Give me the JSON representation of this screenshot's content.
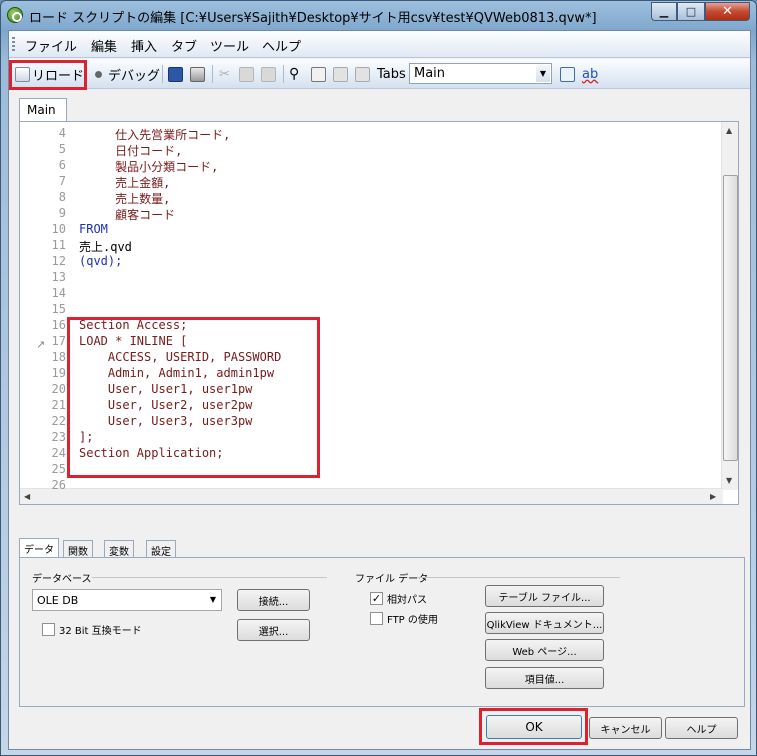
{
  "window": {
    "title": "ロード スクリプトの編集 [C:¥Users¥Sajith¥Desktop¥サイト用csv¥test¥QVWeb0813.qvw*]"
  },
  "menu": [
    "ファイル",
    "編集",
    "挿入",
    "タブ",
    "ツール",
    "ヘルプ"
  ],
  "toolbar": {
    "reload_label": "リロード",
    "debug_label": "デバッグ",
    "tabs_label": "Tabs",
    "tabs_value": "Main"
  },
  "editor_tab": "Main",
  "lines": [
    {
      "n": "4",
      "t": "     仕入先営業所コード,"
    },
    {
      "n": "5",
      "t": "     日付コード,"
    },
    {
      "n": "6",
      "t": "     製品小分類コード,"
    },
    {
      "n": "7",
      "t": "     売上金額,"
    },
    {
      "n": "8",
      "t": "     売上数量,"
    },
    {
      "n": "9",
      "t": "     顧客コード"
    },
    {
      "n": "10",
      "t": "FROM"
    },
    {
      "n": "11",
      "t": "売上.qvd"
    },
    {
      "n": "12",
      "t": "(qvd);"
    },
    {
      "n": "13",
      "t": ""
    },
    {
      "n": "14",
      "t": ""
    },
    {
      "n": "15",
      "t": ""
    },
    {
      "n": "16",
      "t": "Section Access;"
    },
    {
      "n": "17",
      "t": "LOAD * INLINE ["
    },
    {
      "n": "18",
      "t": "    ACCESS, USERID, PASSWORD"
    },
    {
      "n": "19",
      "t": "    Admin, Admin1, admin1pw"
    },
    {
      "n": "20",
      "t": "    User, User1, user1pw"
    },
    {
      "n": "21",
      "t": "    User, User2, user2pw"
    },
    {
      "n": "22",
      "t": "    User, User3, user3pw"
    },
    {
      "n": "23",
      "t": "];"
    },
    {
      "n": "24",
      "t": "Section Application;"
    },
    {
      "n": "25",
      "t": ""
    },
    {
      "n": "26",
      "t": ""
    }
  ],
  "bottom_tabs": [
    "データ",
    "関数",
    "変数",
    "設定"
  ],
  "database": {
    "group_label": "データベース",
    "value": "OLE DB",
    "connect_label": "接続...",
    "select_label": "選択...",
    "compat_label": "32 Bit 互換モード"
  },
  "file_data": {
    "group_label": "ファイル データ",
    "relative_label": "相対パス",
    "ftp_label": "FTP の使用",
    "table_file_label": "テーブル ファイル...",
    "qlikview_doc_label": "QlikView ドキュメント...",
    "web_page_label": "Web ページ...",
    "field_value_label": "項目値..."
  },
  "dialog": {
    "ok_label": "OK",
    "cancel_label": "キャンセル",
    "help_label": "ヘルプ"
  }
}
